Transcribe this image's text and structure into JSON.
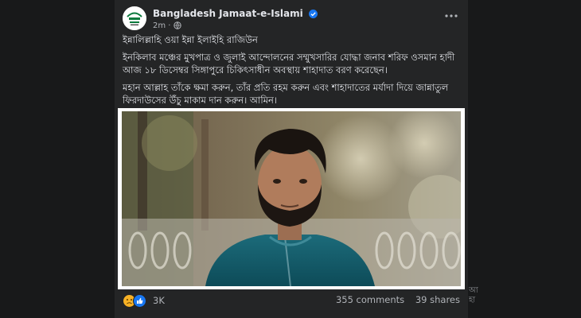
{
  "page": {
    "name": "Bangladesh Jamaat-e-Islami",
    "time": "2m",
    "privacy_icon": "globe-icon",
    "more_icon": "more-horizontal-icon"
  },
  "post": {
    "line1": "ইন্নালিল্লাহি ওয়া ইন্না ইলাইহি রাজিউন",
    "line2": "ইনকিলাব মঞ্চের মুখপাত্র ও জুলাই আন্দোলনের সম্মুখসারির যোদ্ধা জনাব শরিফ ওসমান হাদী আজ ১৮ ডিসেম্বর সিঙ্গাপুরে চিকিৎসাধীন অবস্থায় শাহাদাত বরণ করেছেন।",
    "line3": "মহান আল্লাহ তাঁকে ক্ষমা করুন, তাঁর প্রতি রহম করুন এবং শাহাদাতের মর্যাদা দিয়ে জান্নাতুল ফিরদাউসের উঁচু মাকাম দান করুন। আমিন।"
  },
  "footer": {
    "reaction_count": "3K",
    "comments": "355 comments",
    "shares": "39 shares"
  },
  "side_overflow": "আ হা",
  "colors": {
    "background": "#18191a",
    "card": "#242526",
    "text": "#e4e6eb",
    "muted": "#b0b3b8",
    "verified": "#1877f2"
  }
}
